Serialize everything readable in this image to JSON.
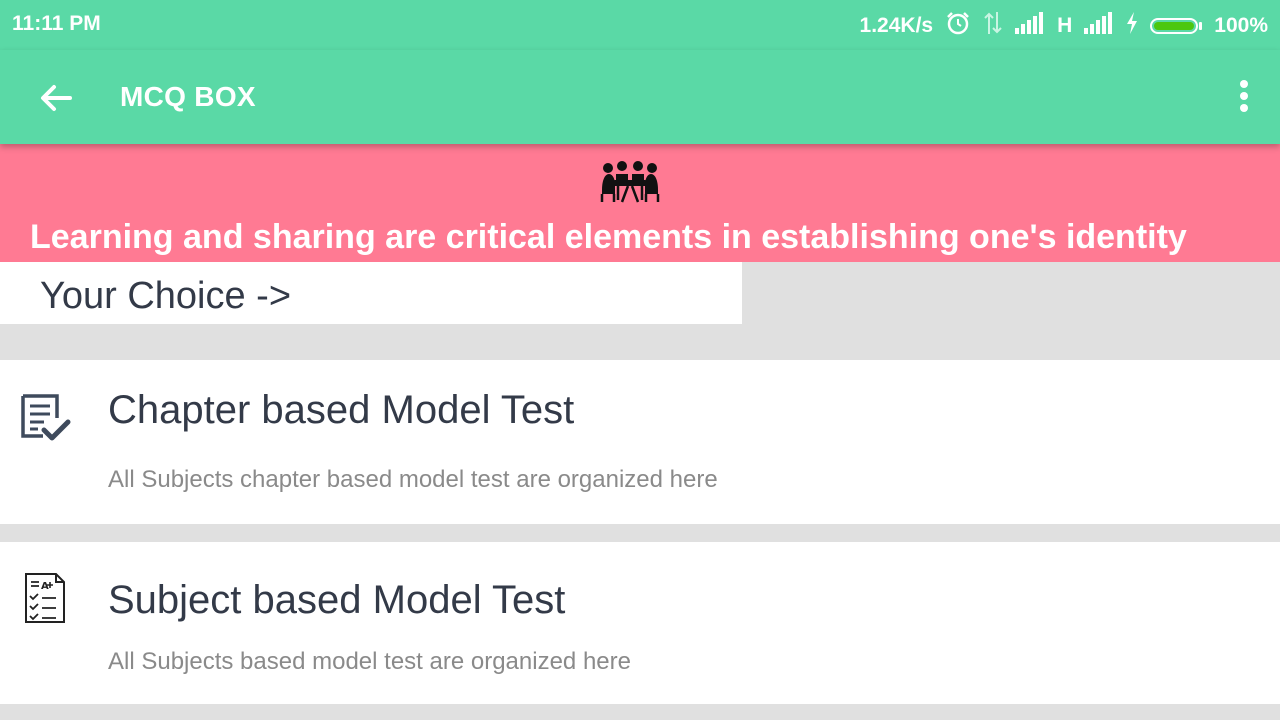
{
  "status_bar": {
    "time": "11:11 PM",
    "network_speed": "1.24K/s",
    "network_type": "H",
    "battery_percent": "100%",
    "battery_level": 1.0,
    "icons": [
      "alarm-icon",
      "data-transfer-icon",
      "signal-icon",
      "signal-icon",
      "charging-icon",
      "battery-icon"
    ]
  },
  "app_bar": {
    "title": "MCQ BOX",
    "back_icon": "arrow-left-icon",
    "menu_icon": "more-vert-icon"
  },
  "banner": {
    "image": "people-meeting-icon",
    "tagline": "Learning and sharing are critical elements in establishing one's identity"
  },
  "section": {
    "title": "Your Choice ->"
  },
  "options": [
    {
      "icon": "checklist-document-icon",
      "title": "Chapter based Model Test",
      "description": "All Subjects chapter based model test are organized here"
    },
    {
      "icon": "quiz-sheet-icon",
      "title": "Subject based Model Test",
      "description": "All Subjects based model test are organized here"
    }
  ],
  "colors": {
    "primary": "#5ad9a6",
    "banner": "#ff7a93",
    "background": "#e0e0e0",
    "heading_text": "#333a48",
    "secondary_text": "#8a8a8a"
  }
}
